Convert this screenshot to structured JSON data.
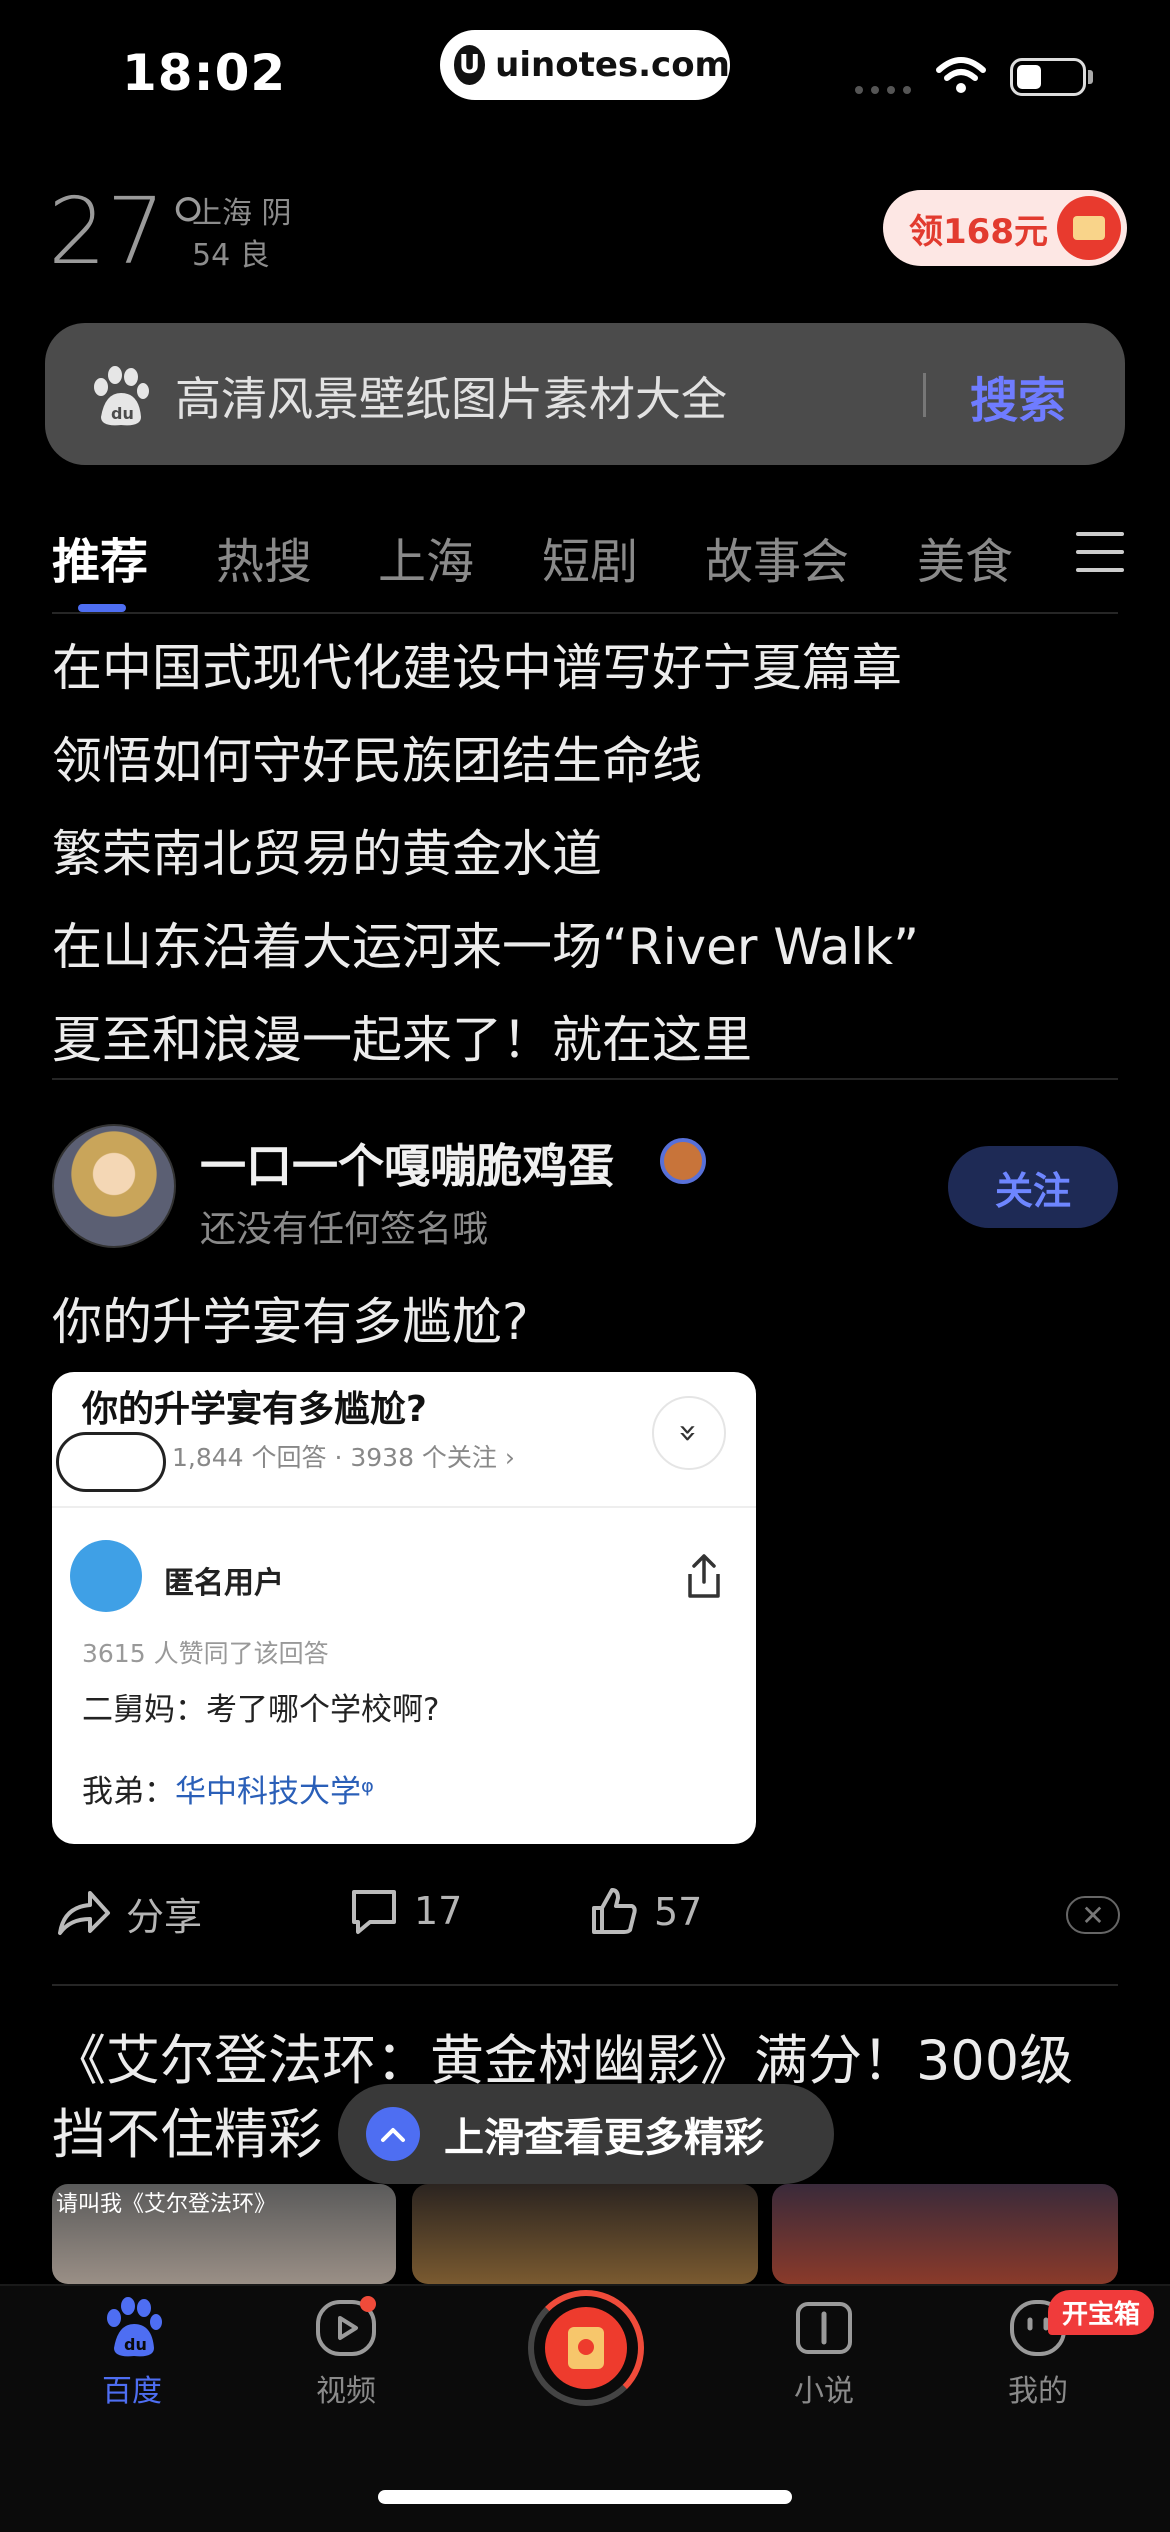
{
  "status_bar": {
    "time": "18:02",
    "url": "uinotes.com",
    "url_logo": "U"
  },
  "weather": {
    "temperature": "27°",
    "city_condition": "上海 阴",
    "aqi": "54 良",
    "red_packet": "领168元"
  },
  "search": {
    "query": "高清风景壁纸图片素材大全",
    "button": "搜索"
  },
  "tabs": [
    "推荐",
    "热搜",
    "上海",
    "短剧",
    "故事会",
    "美食"
  ],
  "hot_list": [
    "在中国式现代化建设中谱写好宁夏篇章",
    "领悟如何守好民族团结生命线",
    "繁荣南北贸易的黄金水道",
    "在山东沿着大运河来一场“River Walk”",
    "夏至和浪漫一起来了！就在这里"
  ],
  "post": {
    "username": "一口一个嘎嘣脆鸡蛋",
    "signature": "还没有任何签名哦",
    "follow": "关注",
    "title": "你的升学宴有多尴尬?",
    "card": {
      "question": "你的升学宴有多尴尬?",
      "meta": "1,844 个回答  ·  3938 个关注 ›",
      "expand": "»",
      "author": "匿名用户",
      "likes": "3615 人赞同了该回答",
      "line1": "二舅妈：考了哪个学校啊?",
      "line2_prefix": "我弟：",
      "line2_link": "华中科技大学",
      "line2_suffix": "ᵠ"
    },
    "actions": {
      "share": "分享",
      "comments": "17",
      "likes": "57"
    },
    "dismiss": "✕"
  },
  "post2": {
    "title": "《艾尔登法环：黄金树幽影》满分！300级挡不住精彩",
    "image_caption": "请叫我《艾尔登法环》"
  },
  "toast": {
    "text": "上滑查看更多精彩",
    "icon": "chevron-up-icon"
  },
  "bottom_nav": {
    "items": [
      "百度",
      "视频",
      "",
      "小说",
      "我的"
    ],
    "badge": "开宝箱"
  },
  "colors": {
    "accent": "#4e6ef2",
    "follow_bg": "#1e2a55",
    "red": "#ee3b2d"
  }
}
